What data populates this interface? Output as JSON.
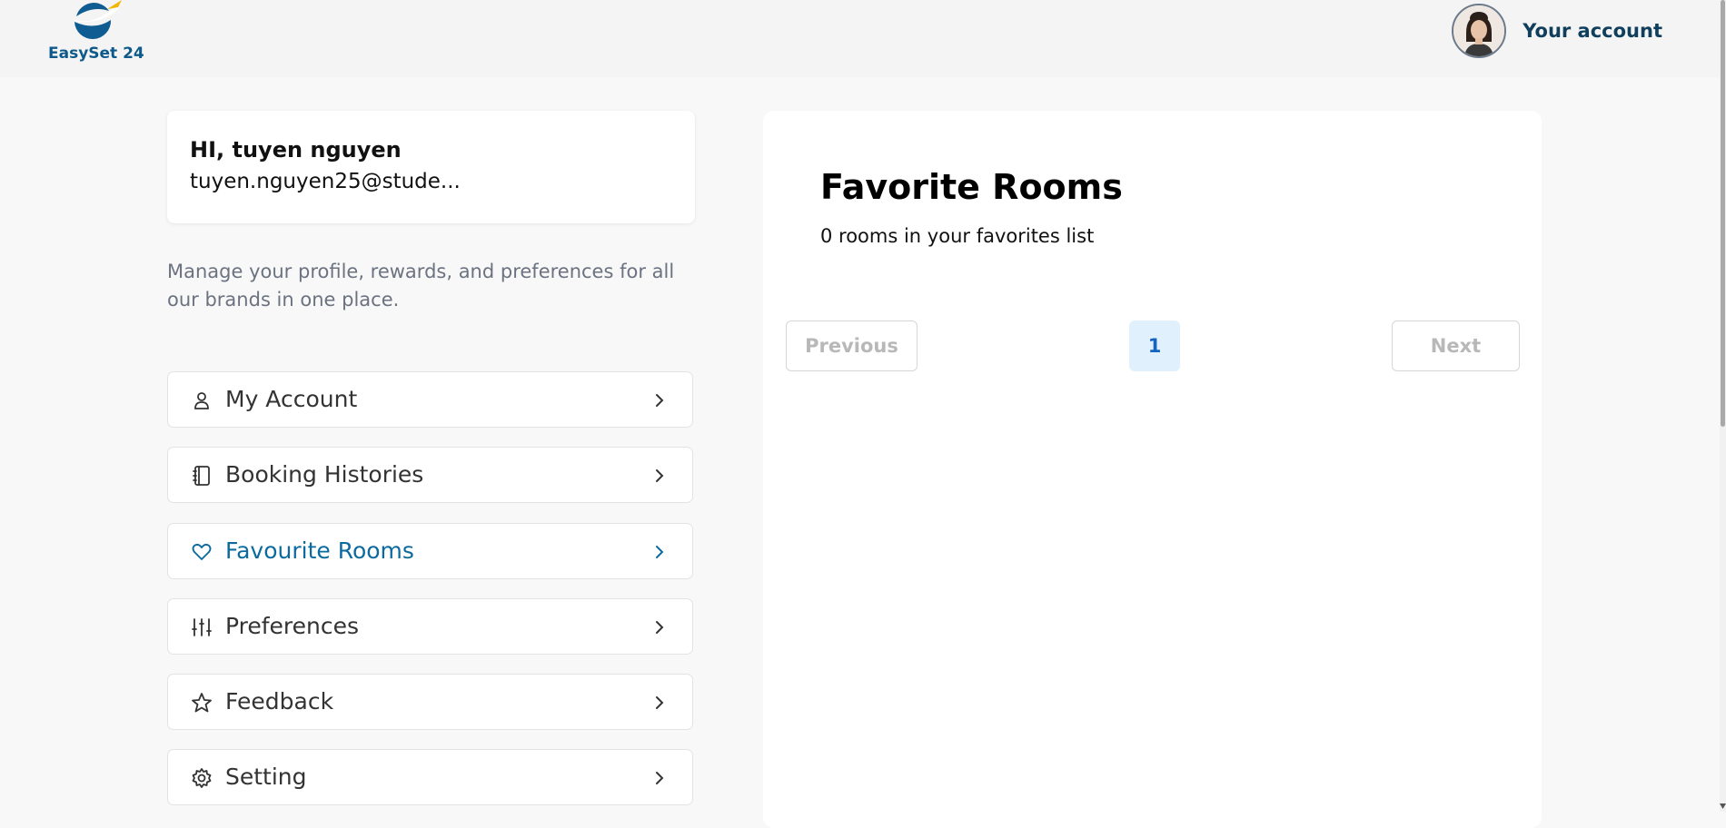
{
  "brand": {
    "name": "EasySet 24",
    "logo_icon": "plane-globe-logo",
    "color": "#0d5a8a"
  },
  "header": {
    "account_label": "Your account",
    "avatar_icon": "user-avatar"
  },
  "profile": {
    "greeting": "HI, tuyen nguyen",
    "email": "tuyen.nguyen25@stude...",
    "description": "Manage your profile, rewards, and preferences for all our brands in one place."
  },
  "menu": [
    {
      "label": "My Account",
      "icon": "user-icon",
      "active": false
    },
    {
      "label": "Booking Histories",
      "icon": "notebook-icon",
      "active": false
    },
    {
      "label": "Favourite Rooms",
      "icon": "heart-icon",
      "active": true
    },
    {
      "label": "Preferences",
      "icon": "sliders-icon",
      "active": false
    },
    {
      "label": "Feedback",
      "icon": "star-icon",
      "active": false
    },
    {
      "label": "Setting",
      "icon": "gear-icon",
      "active": false
    }
  ],
  "main": {
    "title": "Favorite Rooms",
    "subtitle": "0 rooms in your favorites list",
    "pagination": {
      "previous": "Previous",
      "current_page": "1",
      "next": "Next"
    }
  },
  "colors": {
    "accent": "#0d6a9e",
    "page_active_bg": "#e1f0fd",
    "page_active_text": "#1565c0"
  }
}
